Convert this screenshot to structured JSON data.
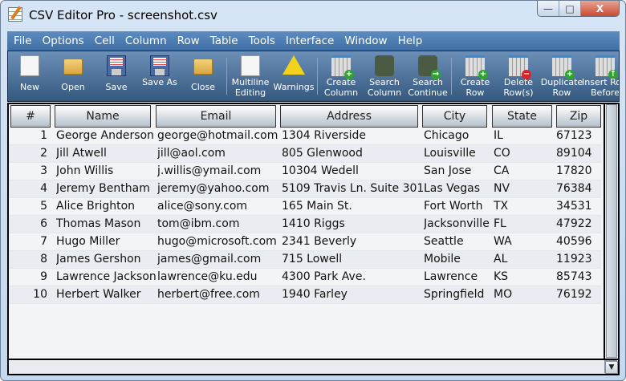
{
  "window": {
    "title": "CSV Editor Pro - screenshot.csv",
    "minimize": "—",
    "maximize": "□",
    "close": "X"
  },
  "menu": [
    "File",
    "Options",
    "Cell",
    "Column",
    "Row",
    "Table",
    "Tools",
    "Interface",
    "Window",
    "Help"
  ],
  "toolbar": [
    {
      "label": "New",
      "icon": "new-file"
    },
    {
      "label": "Open",
      "icon": "open-folder"
    },
    {
      "label": "Save",
      "icon": "floppy-disk"
    },
    {
      "label": "Save As",
      "icon": "floppy-disk-question"
    },
    {
      "label": "Close",
      "icon": "close-folder"
    },
    {
      "label": "Multiline Editing",
      "icon": "document-pencil"
    },
    {
      "label": "Warnings",
      "icon": "warning-triangle"
    },
    {
      "label": "Create Column",
      "icon": "grid-add-column"
    },
    {
      "label": "Search Column",
      "icon": "binoculars"
    },
    {
      "label": "Search Continue",
      "icon": "binoculars-arrow"
    },
    {
      "label": "Create Row",
      "icon": "grid-add-row"
    },
    {
      "label": "Delete Row(s)",
      "icon": "grid-delete-row"
    },
    {
      "label": "Duplicate Row",
      "icon": "grid-duplicate-row"
    },
    {
      "label": "Insert Row Before",
      "icon": "grid-insert-before"
    }
  ],
  "table": {
    "columns": [
      "#",
      "Name",
      "Email",
      "Address",
      "City",
      "State",
      "Zip"
    ],
    "rows": [
      [
        "1",
        "George Anderson",
        "george@hotmail.com",
        "1304 Riverside",
        "Chicago",
        "IL",
        "67123"
      ],
      [
        "2",
        "Jill Atwell",
        "jill@aol.com",
        "805 Glenwood",
        "Louisville",
        "CO",
        "89104"
      ],
      [
        "3",
        "John Willis",
        "j.willis@ymail.com",
        "10304 Wedell",
        "San Jose",
        "CA",
        "17820"
      ],
      [
        "4",
        "Jeremy Bentham",
        "jeremy@yahoo.com",
        "5109 Travis Ln. Suite 301",
        "Las Vegas",
        "NV",
        "76384"
      ],
      [
        "5",
        "Alice Brighton",
        "alice@sony.com",
        "165 Main St.",
        "Fort Worth",
        "TX",
        "34531"
      ],
      [
        "6",
        "Thomas Mason",
        "tom@ibm.com",
        "1410 Riggs",
        "Jacksonville",
        "FL",
        "47922"
      ],
      [
        "7",
        "Hugo Miller",
        "hugo@microsoft.com",
        "2341 Beverly",
        "Seattle",
        "WA",
        "40596"
      ],
      [
        "8",
        "James Gershon",
        "james@gmail.com",
        "715 Lowell",
        "Mobile",
        "AL",
        "11923"
      ],
      [
        "9",
        "Lawrence Jackson",
        "lawrence@ku.edu",
        "4300 Park Ave.",
        "Lawrence",
        "KS",
        "85743"
      ],
      [
        "10",
        "Herbert Walker",
        "herbert@free.com",
        "1940 Farley",
        "Springfield",
        "MO",
        "76192"
      ]
    ]
  }
}
